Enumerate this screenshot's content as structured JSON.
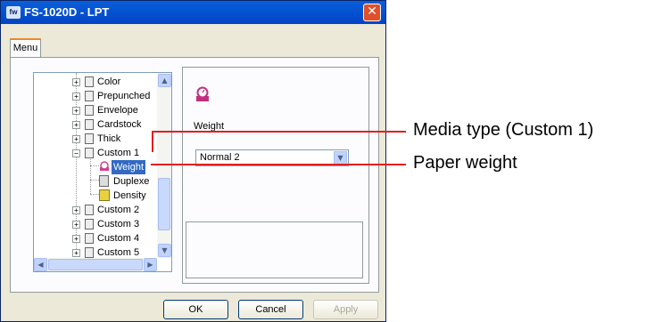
{
  "window": {
    "icon_text": "fw",
    "title": "FS-1020D - LPT",
    "close_label": "✕"
  },
  "tabs": [
    {
      "label": "Menu"
    }
  ],
  "tree": {
    "items": [
      {
        "label": "Color",
        "expander": "+"
      },
      {
        "label": "Prepunched",
        "expander": "+"
      },
      {
        "label": "Envelope",
        "expander": "+"
      },
      {
        "label": "Cardstock",
        "expander": "+"
      },
      {
        "label": "Thick",
        "expander": "+"
      },
      {
        "label": "Custom 1",
        "expander": "−"
      },
      {
        "label": "Weight",
        "selected": true
      },
      {
        "label": "Duplexe"
      },
      {
        "label": "Density"
      },
      {
        "label": "Custom 2",
        "expander": "+"
      },
      {
        "label": "Custom 3",
        "expander": "+"
      },
      {
        "label": "Custom 4",
        "expander": "+"
      },
      {
        "label": "Custom 5",
        "expander": "+"
      }
    ],
    "scroll_up": "▲",
    "scroll_down": "▼",
    "scroll_left": "◀",
    "scroll_right": "▶"
  },
  "settings": {
    "label": "Weight",
    "selected_value": "Normal 2",
    "dropdown_arrow": "▼"
  },
  "buttons": {
    "ok": "OK",
    "cancel": "Cancel",
    "apply": "Apply"
  },
  "callouts": {
    "media_type": "Media type (Custom 1)",
    "paper_weight": "Paper weight"
  },
  "colors": {
    "callout_line": "#e02020",
    "selection": "#316ac5",
    "title_bar": "#0554d2"
  },
  "icons": [
    "page-icon",
    "scale-icon",
    "duplex-icon",
    "density-icon"
  ]
}
